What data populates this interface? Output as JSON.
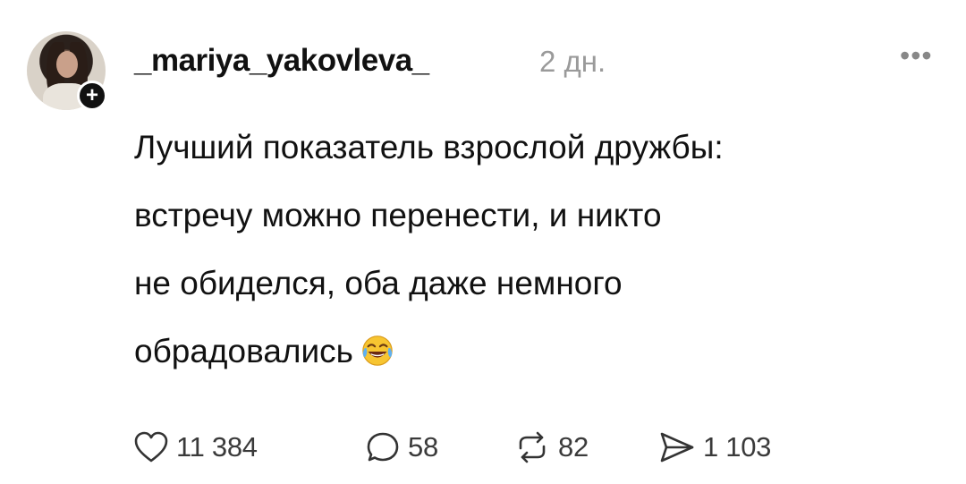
{
  "post": {
    "username": "_mariya_yakovleva_",
    "time": "2 дн.",
    "more_label": "•••",
    "follow_label": "+",
    "lines": [
      "Лучший показатель взрослой дружбы:",
      "встречу можно перенести, и никто",
      "не обиделся, оба даже немного",
      "обрадовались"
    ],
    "emoji": "tears-of-joy-emoji"
  },
  "actions": {
    "likes": "11 384",
    "comments": "58",
    "reposts": "82",
    "shares": "1 103"
  },
  "icons": [
    "heart-icon",
    "comment-icon",
    "repost-icon",
    "share-icon",
    "more-icon"
  ]
}
